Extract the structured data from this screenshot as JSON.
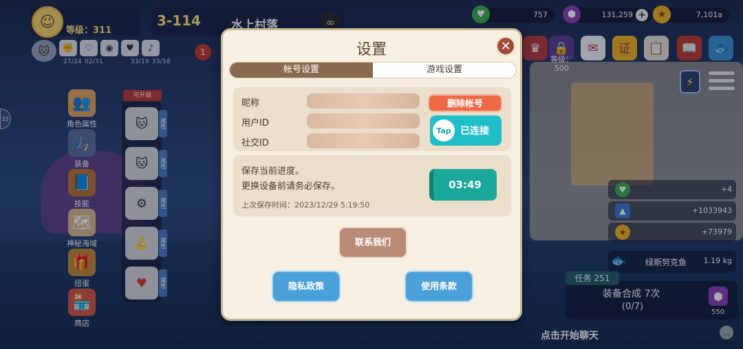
{
  "player": {
    "level_label": "等级：311",
    "avatar_icon": "blonde-character-avatar",
    "mini_stats": [
      "27/24",
      "02/31",
      "33/19",
      "33/58"
    ]
  },
  "stage": {
    "number": "3-114",
    "name": "水上村落",
    "badge": "1"
  },
  "resources": {
    "hearts": "757",
    "gems": "131,259",
    "coins": "7,101a"
  },
  "lock_level": {
    "label": "等级：",
    "value": "500"
  },
  "left_menu": [
    {
      "label": "角色属性",
      "icon": "characters-icon"
    },
    {
      "label": "装备",
      "icon": "fishing-rod-icon"
    },
    {
      "label": "技能",
      "icon": "skill-book-icon"
    },
    {
      "label": "神秘海域",
      "icon": "treasure-map-icon"
    },
    {
      "label": "扭蛋",
      "icon": "treasure-chest-icon"
    },
    {
      "label": "商店",
      "icon": "shop-icon"
    }
  ],
  "upgrade": {
    "tag": "可升级",
    "side_label": "属性"
  },
  "rewards": [
    {
      "icon": "heart-icon",
      "value": "+4"
    },
    {
      "icon": "exp-icon",
      "value": "+1033943"
    },
    {
      "icon": "coin-icon",
      "value": "+73979"
    }
  ],
  "fish": {
    "name": "绿斯努克鱼",
    "weight": "1.19 kg"
  },
  "quest": {
    "tag": "任务 251",
    "title": "装备合成 7次",
    "progress": "(0/7)",
    "reward": "550"
  },
  "chat_hint": "点击开始聊天",
  "dialog": {
    "title": "设置",
    "tabs": [
      "帐号设置",
      "游戏设置"
    ],
    "nickname_label": "昵称",
    "user_id_label": "用户ID",
    "social_id_label": "社交ID",
    "delete_btn": "删除帐号",
    "tap_logo": "Tap",
    "connected": "已连接",
    "save_line1": "保存当前进度。",
    "save_line2": "更换设备前请务必保存。",
    "last_save": "上次保存时间：2023/12/29 5:19:50",
    "save_timer": "03:49",
    "contact": "联系我们",
    "privacy": "隐私政策",
    "terms": "使用条款"
  },
  "colors": {
    "dialog_bg": "#f6efe2",
    "tab_active": "#8a6a4f",
    "delete": "#ee6a45",
    "tap": "#20bfc7",
    "timer": "#1aa89a",
    "blue_btn": "#4aa0d8"
  }
}
